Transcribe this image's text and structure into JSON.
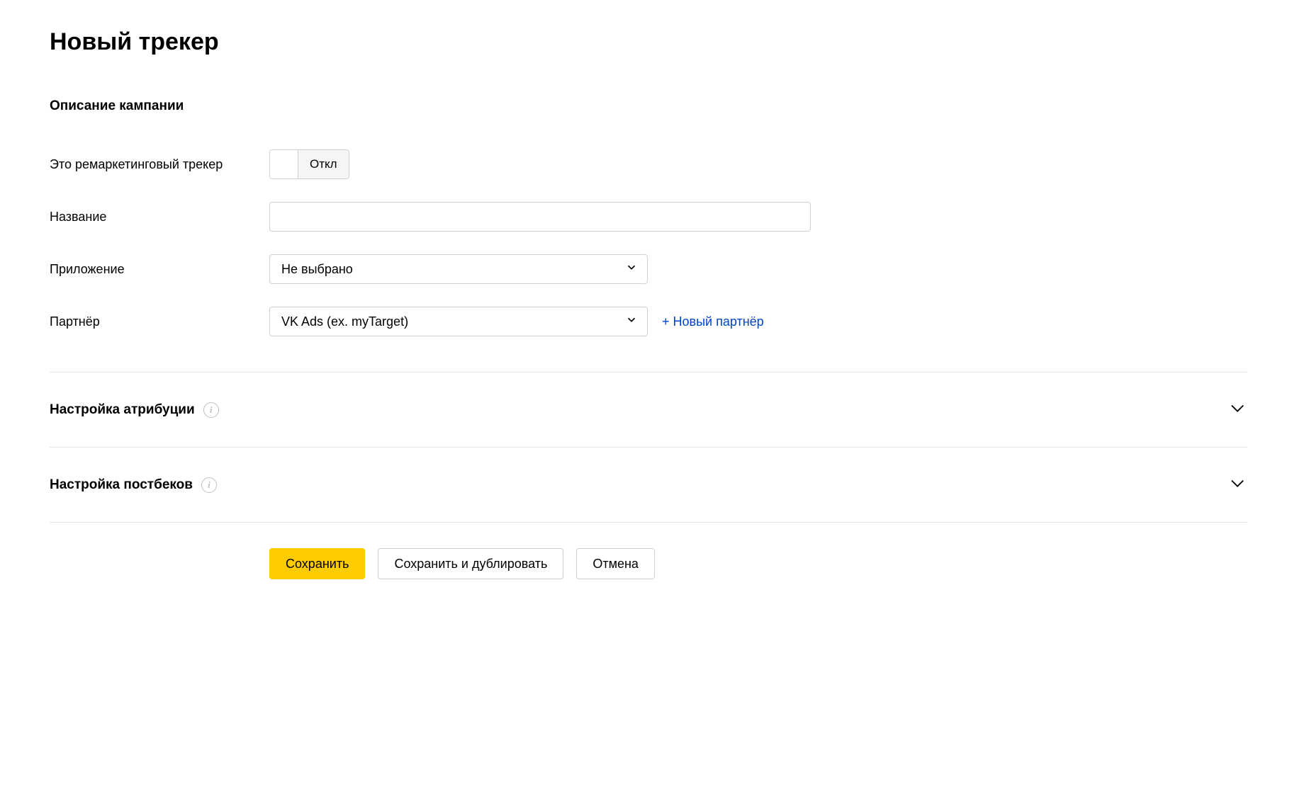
{
  "page": {
    "title": "Новый трекер"
  },
  "section": {
    "campaign_description": "Описание кампании"
  },
  "form": {
    "remarketing": {
      "label": "Это ремаркетинговый трекер",
      "toggle_state": "Откл"
    },
    "name": {
      "label": "Название",
      "value": ""
    },
    "application": {
      "label": "Приложение",
      "selected": "Не выбрано"
    },
    "partner": {
      "label": "Партнёр",
      "selected": "VK Ads (ex. myTarget)",
      "new_partner_link": "+ Новый партнёр"
    }
  },
  "accordions": {
    "attribution": "Настройка атрибуции",
    "postbacks": "Настройка постбеков"
  },
  "buttons": {
    "save": "Сохранить",
    "save_duplicate": "Сохранить и дублировать",
    "cancel": "Отмена"
  }
}
